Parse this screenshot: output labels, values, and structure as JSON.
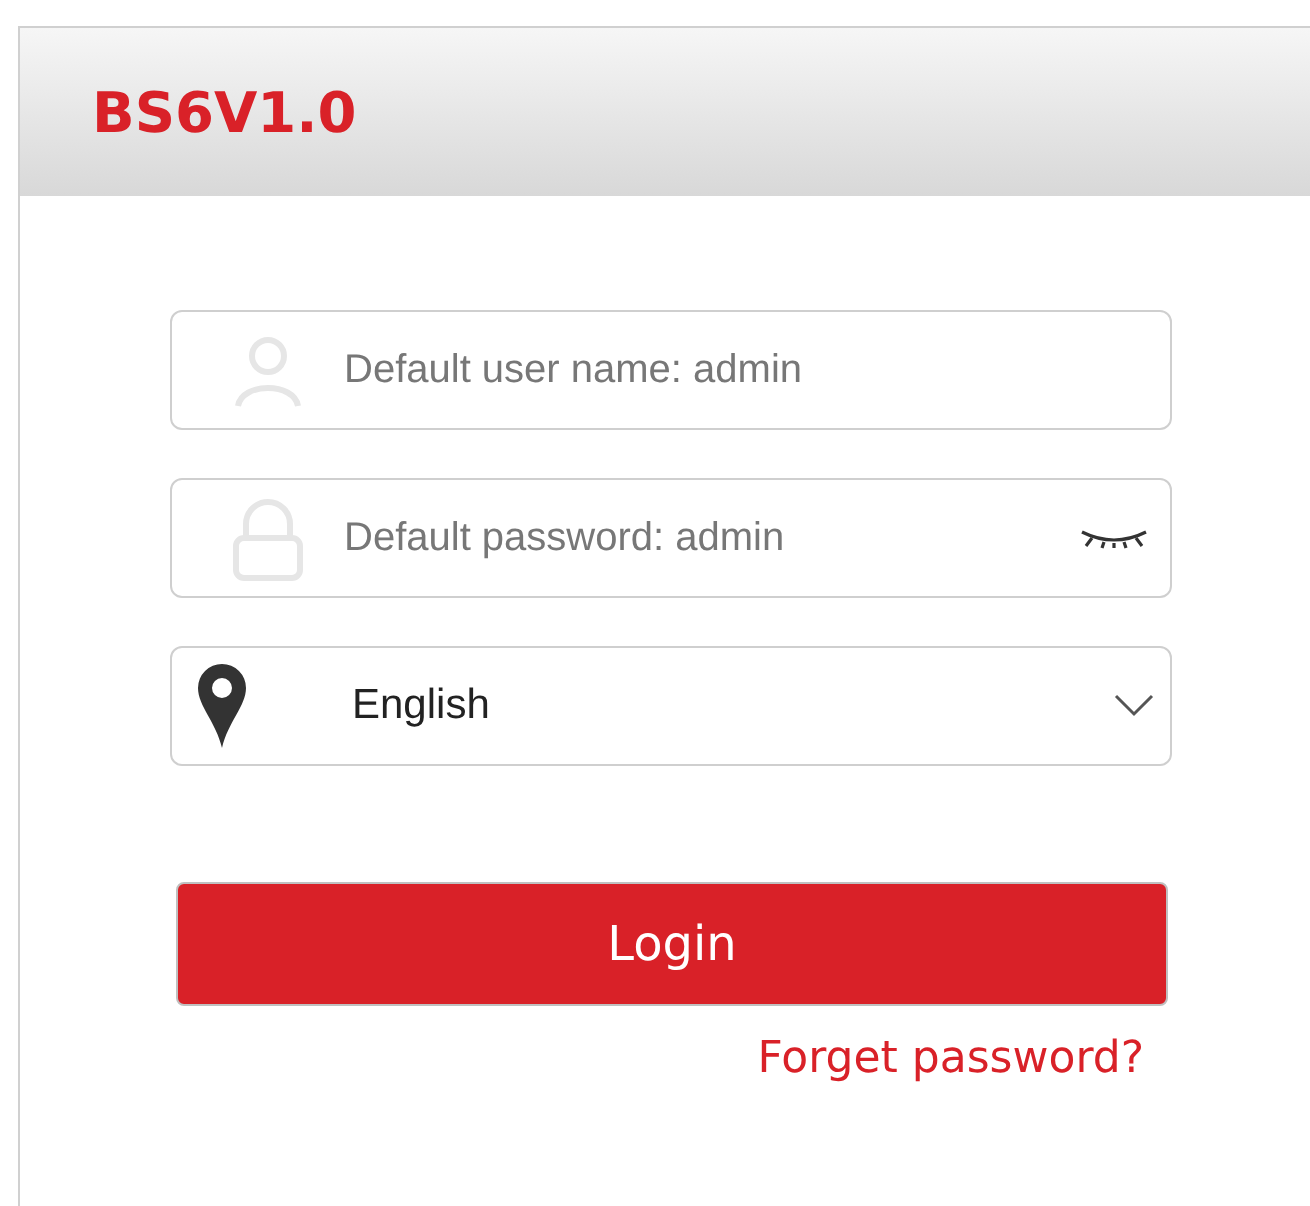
{
  "header": {
    "title": "BS6V1.0"
  },
  "fields": [
    {
      "kind": "user",
      "placeholder": "Default user name: admin"
    },
    {
      "kind": "password",
      "placeholder": "Default password: admin"
    },
    {
      "kind": "language",
      "value": "English"
    }
  ],
  "login_button": "Login",
  "forgot_link": "Forget password?"
}
